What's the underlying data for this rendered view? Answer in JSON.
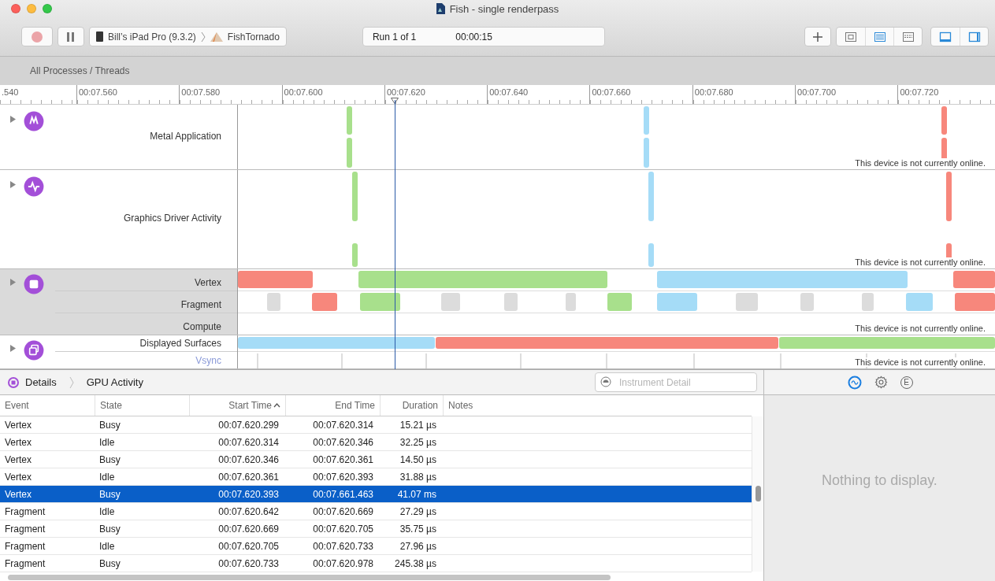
{
  "window": {
    "title": "Fish - single renderpass"
  },
  "toolbar": {
    "recording": false,
    "device": "Bill’s iPad Pro (9.3.2)",
    "target": "FishTornado",
    "run": "Run 1 of 1",
    "elapsed": "00:00:15",
    "view_buttons": [
      {
        "kind": "cpu",
        "on": false
      },
      {
        "kind": "list",
        "on": true
      },
      {
        "kind": "grid",
        "on": false
      }
    ],
    "panel_buttons": [
      {
        "kind": "bottom",
        "on": true
      },
      {
        "kind": "right",
        "on": true
      }
    ]
  },
  "scope_bar": {
    "label": "All Processes / Threads"
  },
  "ruler": {
    "ticks": [
      ".540",
      "00:07.560",
      "00:07.580",
      "00:07.600",
      "00:07.620",
      "00:07.640",
      "00:07.660",
      "00:07.680",
      "00:07.700",
      "00:07.720"
    ]
  },
  "tracks": [
    {
      "grouped": false,
      "lanes": [
        {
          "label": "Metal Application",
          "status": "This device is not currently online."
        }
      ]
    },
    {
      "grouped": false,
      "lanes": [
        {
          "label": "Graphics Driver Activity",
          "status": "This device is not currently online."
        }
      ]
    },
    {
      "grouped": true,
      "lanes": [
        {
          "label": "Vertex"
        },
        {
          "label": "Fragment"
        },
        {
          "label": "Compute",
          "status": "This device is not currently online."
        }
      ]
    },
    {
      "grouped": false,
      "lanes": [
        {
          "label": "Displayed Surfaces"
        },
        {
          "label": "Vsync",
          "kind": "link",
          "status": "This device is not currently online."
        }
      ]
    }
  ],
  "details": {
    "crumbs": [
      "Details",
      "GPU Activity"
    ],
    "search_placeholder": "Instrument Detail"
  },
  "table": {
    "columns": [
      {
        "label": "Event",
        "sorted": false
      },
      {
        "label": "State",
        "sorted": false
      },
      {
        "label": "Start Time",
        "sorted": true
      },
      {
        "label": "End Time",
        "sorted": false
      },
      {
        "label": "Duration",
        "sorted": false
      },
      {
        "label": "Notes",
        "sorted": false
      }
    ],
    "rows": [
      {
        "cells": [
          "Vertex",
          "Busy",
          "00:07.620.299",
          "00:07.620.314",
          "15.21 µs"
        ],
        "selected": false
      },
      {
        "cells": [
          "Vertex",
          "Idle",
          "00:07.620.314",
          "00:07.620.346",
          "32.25 µs"
        ],
        "selected": false
      },
      {
        "cells": [
          "Vertex",
          "Busy",
          "00:07.620.346",
          "00:07.620.361",
          "14.50 µs"
        ],
        "selected": false
      },
      {
        "cells": [
          "Vertex",
          "Idle",
          "00:07.620.361",
          "00:07.620.393",
          "31.88 µs"
        ],
        "selected": false
      },
      {
        "cells": [
          "Vertex",
          "Busy",
          "00:07.620.393",
          "00:07.661.463",
          "41.07 ms"
        ],
        "selected": true
      },
      {
        "cells": [
          "Fragment",
          "Idle",
          "00:07.620.642",
          "00:07.620.669",
          "27.29 µs"
        ],
        "selected": false
      },
      {
        "cells": [
          "Fragment",
          "Busy",
          "00:07.620.669",
          "00:07.620.705",
          "35.75 µs"
        ],
        "selected": false
      },
      {
        "cells": [
          "Fragment",
          "Idle",
          "00:07.620.705",
          "00:07.620.733",
          "27.96 µs"
        ],
        "selected": false
      },
      {
        "cells": [
          "Fragment",
          "Busy",
          "00:07.620.733",
          "00:07.620.978",
          "245.38 µs"
        ],
        "selected": false
      }
    ]
  },
  "inspector": {
    "tabs": [
      {
        "kind": "wave",
        "selected": true
      },
      {
        "kind": "gear",
        "selected": false
      },
      {
        "kind": "letter",
        "label": "E",
        "selected": false
      }
    ],
    "empty": "Nothing to display."
  }
}
